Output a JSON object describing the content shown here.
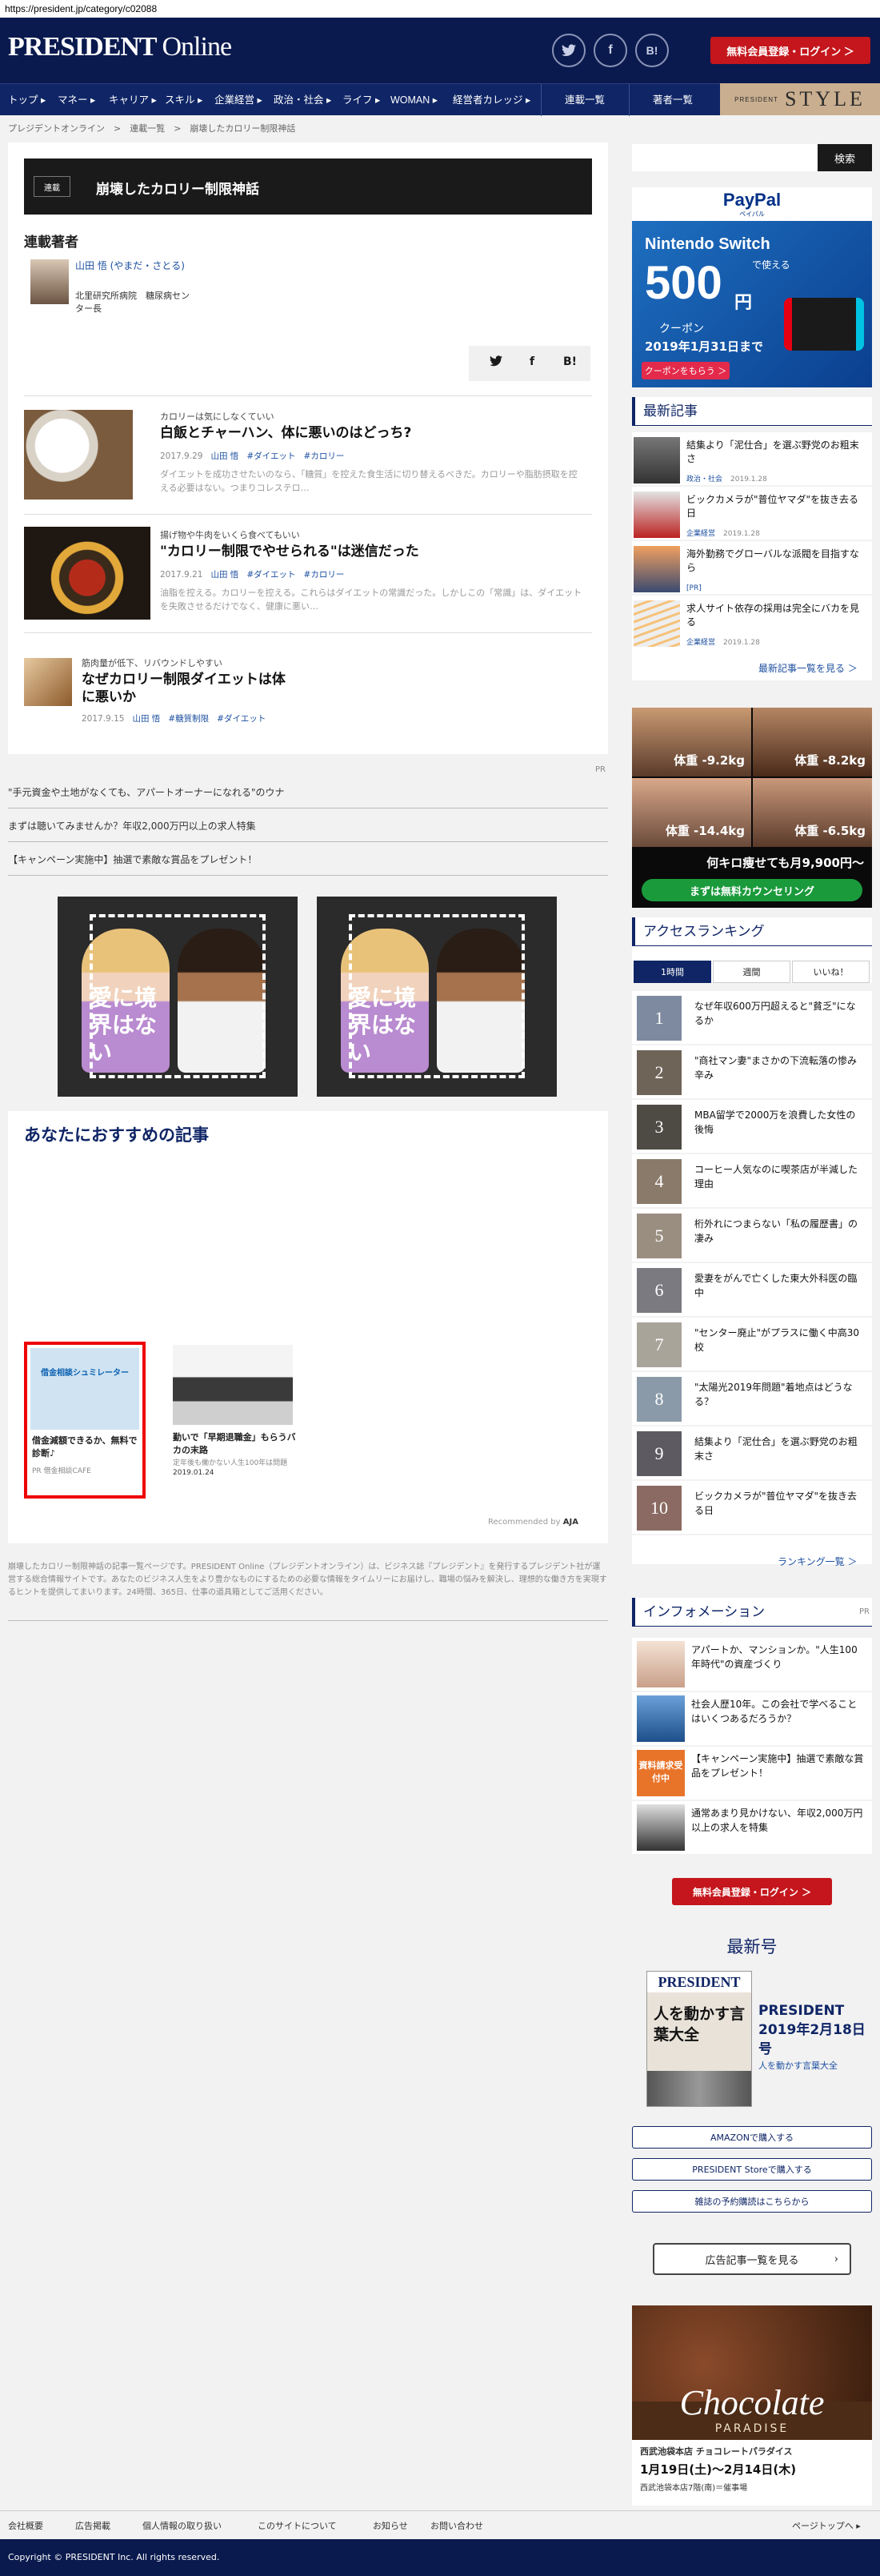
{
  "url": "https://president.jp/category/c02088",
  "header": {
    "logo_main": "PRESIDENT",
    "logo_sub": "Online",
    "social": [
      "twitter-icon",
      "facebook-icon",
      "B!"
    ],
    "login_label": "無料会員登録・ログイン ＞"
  },
  "nav": {
    "items": [
      "トップ ▸",
      "マネー ▸",
      "キャリア ▸",
      "スキル ▸",
      "企業経営 ▸",
      "政治・社会 ▸",
      "ライフ ▸",
      "WOMAN ▸",
      "経営者カレッジ ▸"
    ],
    "series": "連載一覧",
    "authors": "著者一覧",
    "style_small": "PRESIDENT",
    "style_big": "STYLE"
  },
  "breadcrumb": "プレジデントオンライン　>　連載一覧　>　崩壊したカロリー制限神話",
  "category": {
    "tag": "連載",
    "title": "崩壊したカロリー制限神話"
  },
  "author": {
    "heading": "連載著者",
    "name": "山田 悟 (やまだ・さとる)",
    "role": "北里研究所病院　糖尿病センター長"
  },
  "share": [
    "twitter-icon",
    "f",
    "B!"
  ],
  "articles": [
    {
      "kicker": "カロリーは気にしなくていい",
      "title": "白飯とチャーハン、体に悪いのはどっち?",
      "date": "2017.9.29",
      "author": "山田 悟",
      "tags": [
        "#ダイエット",
        "#カロリー"
      ],
      "desc": "ダイエットを成功させたいのなら、「糖質」を控えた食生活に切り替えるべきだ。カロリーや脂肪摂取を控える必要はない。つまりコレステロ…"
    },
    {
      "kicker": "揚げ物や牛肉をいくら食べてもいい",
      "title": "\"カロリー制限でやせられる\"は迷信だった",
      "date": "2017.9.21",
      "author": "山田 悟",
      "tags": [
        "#ダイエット",
        "#カロリー"
      ],
      "desc": "油脂を控える。カロリーを控える。これらはダイエットの常識だった。しかしこの「常識」は、ダイエットを失敗させるだけでなく、健康に悪い…"
    },
    {
      "kicker": "筋肉量が低下、リバウンドしやすい",
      "title": "なぜカロリー制限ダイエットは体に悪いか",
      "date": "2017.9.15",
      "author": "山田 悟",
      "tags": [
        "#糖質制限",
        "#ダイエット"
      ],
      "desc": ""
    }
  ],
  "pr": {
    "label": "PR",
    "lines": [
      "\"手元資金や土地がなくても、アパートオーナーになれる\"のウナ",
      "まずは聴いてみませんか？年収2,000万円以上の求人特集",
      "【キャンペーン実施中】抽選で素敵な賞品をプレゼント！"
    ]
  },
  "ad_cards": [
    {
      "text": "愛に境界はない"
    },
    {
      "text": "愛に境界はない"
    }
  ],
  "reco": {
    "heading": "あなたにおすすめの記事",
    "items": [
      {
        "title": "借金減額できるか、無料で診断♪",
        "source": "PR 借金相談CAFE",
        "thumb": "借金相談シュミレーター"
      },
      {
        "title": "勤いで「早期退職金」もらうバカの末路",
        "source": "定年後も働かない人生100年は問題",
        "date": "2019.01.24"
      }
    ],
    "by": "Recommended by",
    "by_brand": "AJA"
  },
  "footer_desc": "崩壊したカロリー制限神話の記事一覧ページです。PRESIDENT Online（プレジデントオンライン）は、ビジネス誌『プレジデント』を発行するプレジデント社が運営する総合情報サイトです。あなたのビジネス人生をより豊かなものにするための必要な情報をタイムリーにお届けし、職場の悩みを解決し、理想的な働き方を実現するヒントを提供してまいります。24時間、365日、仕事の道具箱としてご活用ください。",
  "sidebar": {
    "search_button": "検索",
    "paypal": {
      "brand": "PayPal",
      "brand_sub": "ペイパル",
      "line1": "Nintendo Switch",
      "line2": "で使える",
      "amount": "500",
      "yen": "円",
      "coupon": "クーポン",
      "deadline": "2019年1月31日まで",
      "cta": "クーポンをもらう ＞"
    },
    "latest_heading": "最新記事",
    "latest": [
      {
        "title": "結集より「泥仕合」を選ぶ野党のお粗末さ",
        "cat": "政治・社会",
        "date": "2019.1.28"
      },
      {
        "title": "ビックカメラが\"普位ヤマダ\"を抜き去る日",
        "cat": "企業経営",
        "date": "2019.1.28"
      },
      {
        "title": "海外勤務でグローバルな派閥を目指すなら",
        "cat": "[PR]",
        "date": ""
      },
      {
        "title": "求人サイト依存の採用は完全にバカを見る",
        "cat": "企業経営",
        "date": "2019.1.28"
      }
    ],
    "latest_more": "最新記事一覧を見る ＞",
    "diet_ad": {
      "cells": [
        "体重 -9.2kg",
        "体重 -8.2kg",
        "体重 -14.4kg",
        "体重 -6.5kg"
      ],
      "banner": "何キロ痩せても月9,900円〜",
      "cta": "まずは無料カウンセリング"
    },
    "ranking_heading": "アクセスランキング",
    "ranking_tabs": [
      "1時間",
      "週間",
      "いいね！"
    ],
    "ranking": [
      {
        "rank": "1",
        "title": "なぜ年収600万円超えると\"貧乏\"になるか"
      },
      {
        "rank": "2",
        "title": "\"商社マン妻\"まさかの下流転落の惨み辛み"
      },
      {
        "rank": "3",
        "title": "MBA留学で2000万を浪費した女性の後悔"
      },
      {
        "rank": "4",
        "title": "コーヒー人気なのに喫茶店が半減した理由"
      },
      {
        "rank": "5",
        "title": "桁外れにつまらない「私の履歴書」の凄み"
      },
      {
        "rank": "6",
        "title": "愛妻をがんで亡くした東大外科医の臨中"
      },
      {
        "rank": "7",
        "title": "\"センター廃止\"がプラスに働く中高30校"
      },
      {
        "rank": "8",
        "title": "\"太陽光2019年問題\"着地点はどうなる？"
      },
      {
        "rank": "9",
        "title": "結集より「泥仕合」を選ぶ野党のお粗末さ"
      },
      {
        "rank": "10",
        "title": "ビックカメラが\"普位ヤマダ\"を抜き去る日"
      }
    ],
    "ranking_more": "ランキング一覧 ＞",
    "info_heading": "インフォメーション",
    "info_pr": "PR",
    "info": [
      {
        "title": "アパートか、マンションか。\"人生100年時代\"の資産づくり"
      },
      {
        "title": "社会人歴10年。この会社で学べることはいくつあるだろうか？"
      },
      {
        "title": "【キャンペーン実施中】抽選で素敵な賞品をプレゼント！",
        "badge": "資料請求受付中"
      },
      {
        "title": "通常あまり見かけない、年収2,000万円以上の求人を特集"
      }
    ],
    "login_label": "無料会員登録・ログイン ＞",
    "issue_heading": "最新号",
    "issue_title": "PRESIDENT 2019年2月18日号",
    "issue_sub": "人を動かす言葉大全",
    "cover_logo": "PRESIDENT",
    "cover_text": "人を動かす言葉大全",
    "buttons": [
      "AMAZONで購入する",
      "PRESIDENT Storeで購入する",
      "雑誌の予約購読はこちらから"
    ],
    "adlist_label": "広告記事一覧を見る",
    "choco": {
      "title": "Chocolate",
      "sub": "PARADISE",
      "store": "西武池袋本店 チョコレートパラダイス",
      "dates": "1月19日(土)〜2月14日(木)",
      "place": "西武池袋本店7階(南)＝催事場"
    }
  },
  "footer": {
    "links": [
      "会社概要",
      "広告掲載",
      "個人情報の取り扱い",
      "このサイトについて",
      "お知らせ",
      "お問い合わせ"
    ],
    "pagetop": "ページトップへ ▸",
    "copyright": "Copyright © PRESIDENT Inc. All rights reserved."
  }
}
